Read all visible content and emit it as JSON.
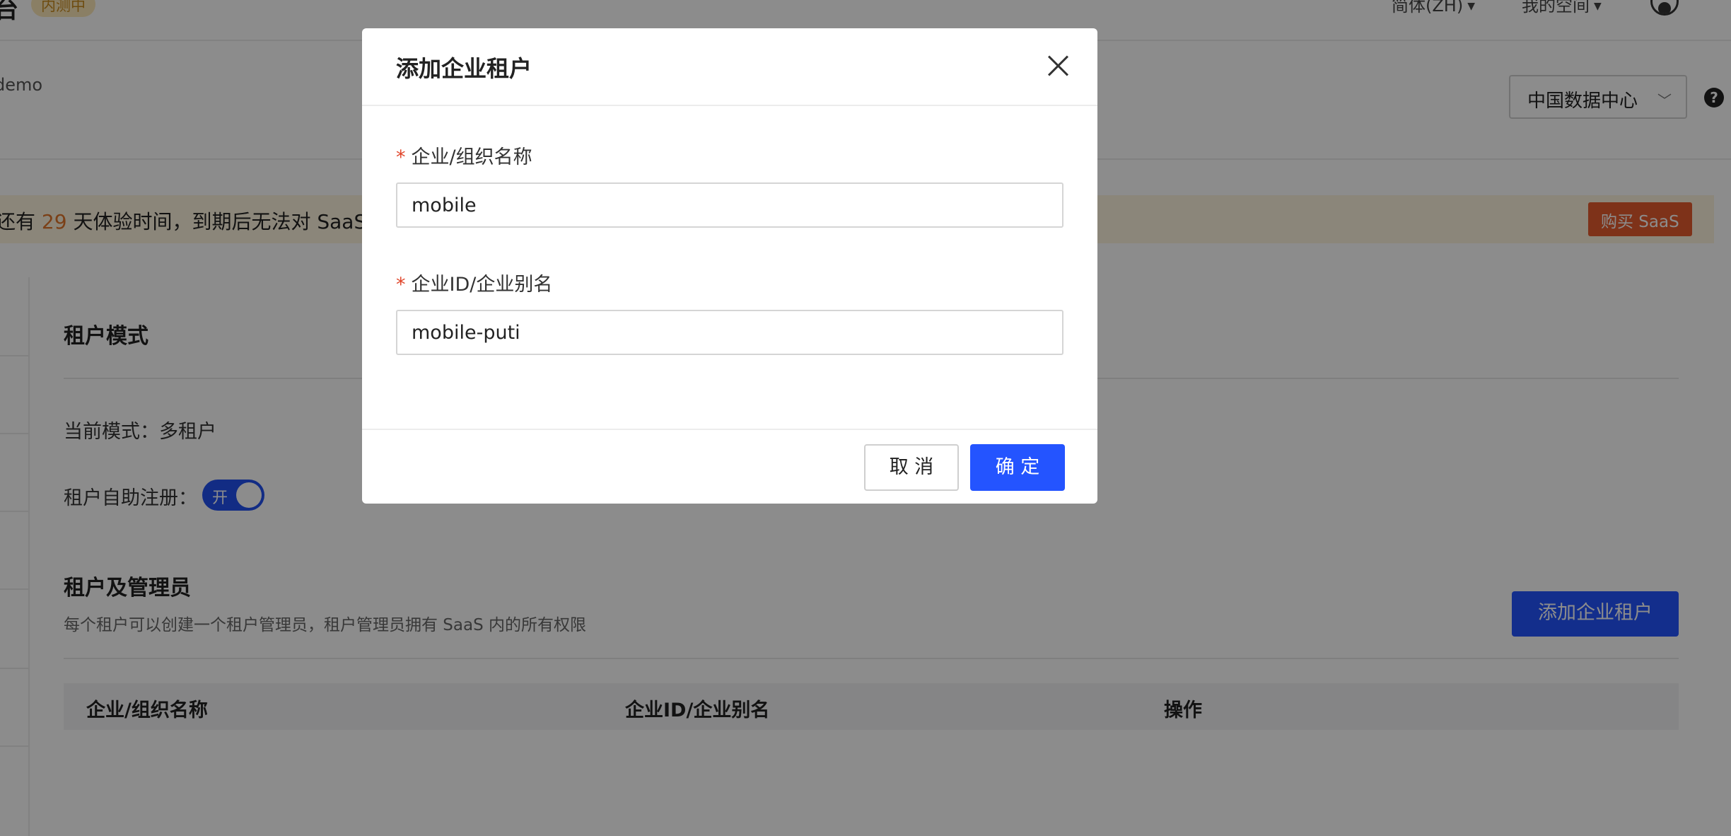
{
  "topbar": {
    "brand_char": "台",
    "badge": "内测中",
    "language": "简体(ZH)",
    "space": "我的空间"
  },
  "subheader": {
    "project": "demo",
    "datacenter": "中国数据中心",
    "help": "?"
  },
  "banner": {
    "prefix": "还有 ",
    "days": "29",
    "suffix": " 天体验时间，到期后无法对 SaaS",
    "buy_label": "购买 SaaS"
  },
  "tenant_mode": {
    "title": "租户模式",
    "current_mode": "当前模式：多租户",
    "self_register_label": "租户自助注册：",
    "toggle_text": "开"
  },
  "tenants": {
    "title": "租户及管理员",
    "description": "每个租户可以创建一个租户管理员，租户管理员拥有 SaaS 内的所有权限",
    "add_button": "添加企业租户",
    "columns": [
      "企业/组织名称",
      "企业ID/企业别名",
      "操作"
    ]
  },
  "modal": {
    "title": "添加企业租户",
    "required_mark": "*",
    "name_label": "企业/组织名称",
    "name_value": "mobile",
    "id_label": "企业ID/企业别名",
    "id_value": "mobile-puti",
    "cancel_label": "取 消",
    "confirm_label": "确 定"
  }
}
